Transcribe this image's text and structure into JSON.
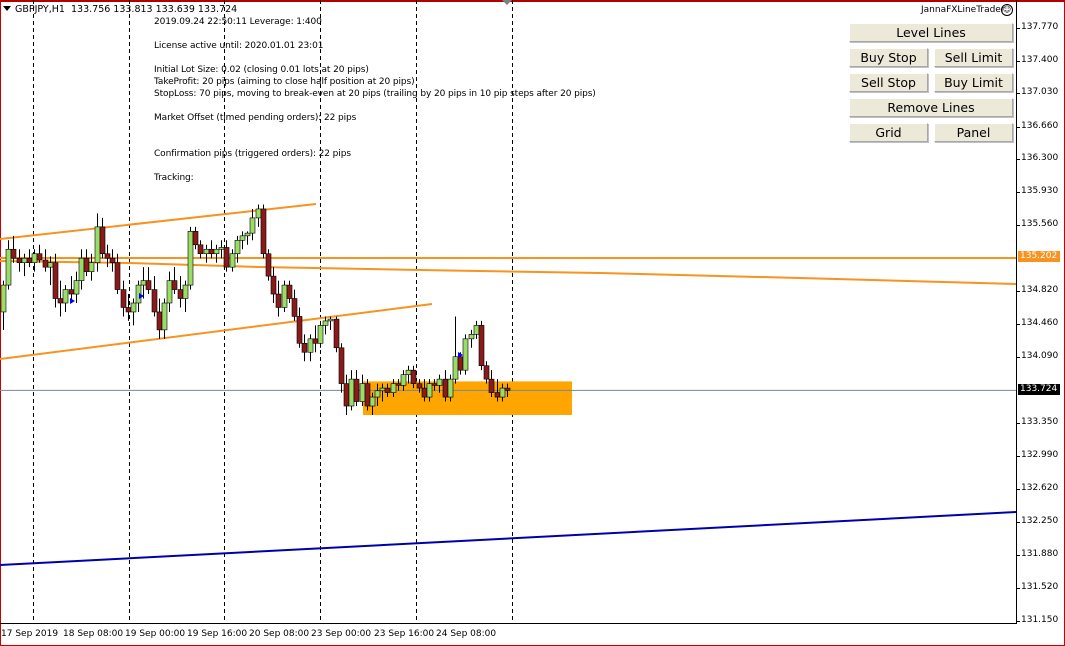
{
  "chart_header": {
    "symbol_timeframe": "GBPJPY,H1",
    "ohlc": "133.756 133.813 133.639 133.724"
  },
  "ea_info": {
    "name": "JannaFXLineTrader",
    "smiley": "☺",
    "lines": [
      "2019.09.24 22:50:11    Leverage: 1:400",
      "License active until: 2020.01.01 23:01",
      "Initial Lot Size: 0.02  (closing 0.01 lots at 20 pips)",
      "TakeProfit: 20 pips  (aiming to close half position at 20 pips)",
      "StopLoss: 70 pips, moving to break-even at 20 pips  (trailing by 20 pips in 10 pip steps after 20 pips)",
      "Market Offset (timed pending orders): 22 pips",
      "Confirmation pips (triggered orders): 22 pips",
      "Tracking:"
    ]
  },
  "panel": {
    "level_lines": "Level Lines",
    "buy_stop": "Buy Stop",
    "sell_limit": "Sell Limit",
    "sell_stop": "Sell Stop",
    "buy_limit": "Buy Limit",
    "remove_lines": "Remove Lines",
    "grid": "Grid",
    "panel": "Panel"
  },
  "colors": {
    "bull": "#99dd66",
    "bear": "#8b1a1a",
    "trendline": "#f7931e",
    "support_line": "#0000aa",
    "zone": "#ffa500",
    "bid_line": "#778899",
    "bid_tag_bg": "#000000",
    "level_tag_bg": "#f7931e"
  },
  "chart_data": {
    "type": "candlestick",
    "symbol": "GBPJPY",
    "timeframe": "H1",
    "y_ticks": [
      "137.770",
      "137.400",
      "137.030",
      "136.660",
      "136.300",
      "135.930",
      "135.560",
      "135.202",
      "134.820",
      "134.460",
      "134.090",
      "133.724",
      "133.350",
      "132.990",
      "132.620",
      "132.250",
      "131.880",
      "131.520",
      "131.150"
    ],
    "y_tick_values": [
      137.77,
      137.4,
      137.03,
      136.66,
      136.3,
      135.93,
      135.56,
      134.82,
      134.46,
      134.09,
      133.35,
      132.99,
      132.62,
      132.25,
      131.88,
      131.52,
      131.15
    ],
    "ylim": [
      131.15,
      137.95
    ],
    "x_ticks": [
      "17 Sep 2019",
      "18 Sep 08:00",
      "19 Sep 00:00",
      "19 Sep 16:00",
      "20 Sep 08:00",
      "23 Sep 00:00",
      "23 Sep 16:00",
      "24 Sep 08:00"
    ],
    "current_bid": 133.724,
    "level_line_price": 135.202,
    "candles": [
      [
        134.6,
        134.95,
        134.4,
        134.9
      ],
      [
        134.9,
        135.4,
        134.85,
        135.3
      ],
      [
        135.3,
        135.45,
        135.15,
        135.2
      ],
      [
        135.2,
        135.3,
        135.05,
        135.15
      ],
      [
        135.15,
        135.25,
        135.0,
        135.2
      ],
      [
        135.2,
        135.3,
        135.1,
        135.15
      ],
      [
        135.15,
        135.3,
        135.05,
        135.25
      ],
      [
        135.25,
        135.35,
        135.15,
        135.18
      ],
      [
        135.18,
        135.3,
        135.05,
        135.1
      ],
      [
        135.1,
        135.22,
        134.9,
        135.15
      ],
      [
        135.15,
        135.25,
        134.65,
        134.75
      ],
      [
        134.75,
        134.95,
        134.55,
        134.7
      ],
      [
        134.7,
        134.9,
        134.6,
        134.85
      ],
      [
        134.85,
        135.0,
        134.7,
        134.8
      ],
      [
        134.8,
        135.05,
        134.7,
        134.95
      ],
      [
        134.95,
        135.3,
        134.85,
        135.2
      ],
      [
        135.2,
        135.3,
        135.0,
        135.05
      ],
      [
        135.05,
        135.25,
        134.95,
        135.15
      ],
      [
        135.15,
        135.7,
        135.05,
        135.55
      ],
      [
        135.55,
        135.65,
        135.2,
        135.25
      ],
      [
        135.25,
        135.35,
        135.1,
        135.2
      ],
      [
        135.2,
        135.3,
        135.05,
        135.15
      ],
      [
        135.15,
        135.25,
        134.8,
        134.85
      ],
      [
        134.85,
        134.95,
        134.55,
        134.65
      ],
      [
        134.65,
        134.8,
        134.5,
        134.6
      ],
      [
        134.6,
        134.75,
        134.45,
        134.7
      ],
      [
        134.7,
        134.95,
        134.6,
        134.9
      ],
      [
        134.9,
        135.1,
        134.75,
        134.95
      ],
      [
        134.95,
        135.1,
        134.8,
        134.85
      ],
      [
        134.85,
        135.0,
        134.55,
        134.6
      ],
      [
        134.6,
        134.75,
        134.3,
        134.4
      ],
      [
        134.4,
        134.75,
        134.3,
        134.7
      ],
      [
        134.7,
        135.05,
        134.6,
        134.95
      ],
      [
        134.95,
        135.1,
        134.8,
        134.85
      ],
      [
        134.85,
        135.0,
        134.65,
        134.75
      ],
      [
        134.75,
        134.95,
        134.6,
        134.9
      ],
      [
        134.9,
        135.55,
        134.85,
        135.5
      ],
      [
        135.5,
        135.55,
        135.3,
        135.35
      ],
      [
        135.35,
        135.4,
        135.2,
        135.25
      ],
      [
        135.25,
        135.35,
        135.15,
        135.3
      ],
      [
        135.3,
        135.4,
        135.2,
        135.25
      ],
      [
        135.25,
        135.35,
        135.15,
        135.3
      ],
      [
        135.3,
        135.4,
        135.2,
        135.32
      ],
      [
        135.32,
        135.4,
        135.05,
        135.1
      ],
      [
        135.1,
        135.3,
        135.05,
        135.25
      ],
      [
        135.25,
        135.45,
        135.15,
        135.4
      ],
      [
        135.4,
        135.5,
        135.3,
        135.45
      ],
      [
        135.45,
        135.5,
        135.35,
        135.48
      ],
      [
        135.48,
        135.75,
        135.4,
        135.65
      ],
      [
        135.65,
        135.8,
        135.55,
        135.75
      ],
      [
        135.75,
        135.8,
        135.2,
        135.25
      ],
      [
        135.25,
        135.3,
        134.95,
        135.0
      ],
      [
        135.0,
        135.1,
        134.7,
        134.8
      ],
      [
        134.8,
        134.95,
        134.55,
        134.65
      ],
      [
        134.65,
        134.95,
        134.6,
        134.9
      ],
      [
        134.9,
        134.95,
        134.7,
        134.75
      ],
      [
        134.75,
        134.85,
        134.5,
        134.55
      ],
      [
        134.55,
        134.65,
        134.2,
        134.25
      ],
      [
        134.25,
        134.35,
        134.05,
        134.15
      ],
      [
        134.15,
        134.35,
        134.05,
        134.3
      ],
      [
        134.3,
        134.45,
        134.15,
        134.25
      ],
      [
        134.25,
        134.5,
        134.2,
        134.45
      ],
      [
        134.45,
        134.55,
        134.35,
        134.5
      ],
      [
        134.5,
        134.55,
        134.4,
        134.52
      ],
      [
        134.52,
        134.55,
        134.15,
        134.2
      ],
      [
        134.2,
        134.25,
        133.7,
        133.8
      ],
      [
        133.8,
        133.9,
        133.45,
        133.55
      ],
      [
        133.55,
        133.95,
        133.5,
        133.85
      ],
      [
        133.85,
        133.95,
        133.55,
        133.6
      ],
      [
        133.6,
        133.9,
        133.55,
        133.8
      ],
      [
        133.8,
        133.85,
        133.5,
        133.55
      ],
      [
        133.55,
        133.7,
        133.45,
        133.65
      ],
      [
        133.65,
        133.8,
        133.55,
        133.72
      ],
      [
        133.72,
        133.8,
        133.6,
        133.75
      ],
      [
        133.75,
        133.8,
        133.65,
        133.7
      ],
      [
        133.7,
        133.85,
        133.65,
        133.8
      ],
      [
        133.8,
        133.85,
        133.72,
        133.78
      ],
      [
        133.78,
        133.95,
        133.72,
        133.9
      ],
      [
        133.9,
        134.0,
        133.8,
        133.95
      ],
      [
        133.95,
        134.0,
        133.75,
        133.8
      ],
      [
        133.8,
        133.85,
        133.7,
        133.75
      ],
      [
        133.75,
        133.85,
        133.6,
        133.65
      ],
      [
        133.65,
        133.85,
        133.6,
        133.8
      ],
      [
        133.8,
        133.85,
        133.72,
        133.78
      ],
      [
        133.78,
        133.9,
        133.7,
        133.85
      ],
      [
        133.85,
        133.95,
        133.6,
        133.65
      ],
      [
        133.65,
        133.9,
        133.6,
        133.85
      ],
      [
        133.85,
        134.55,
        133.8,
        134.1
      ],
      [
        134.1,
        134.15,
        133.9,
        133.95
      ],
      [
        133.95,
        134.35,
        133.9,
        134.3
      ],
      [
        134.3,
        134.4,
        134.2,
        134.35
      ],
      [
        134.35,
        134.5,
        134.3,
        134.45
      ],
      [
        134.45,
        134.5,
        133.95,
        134.0
      ],
      [
        134.0,
        134.05,
        133.8,
        133.85
      ],
      [
        133.85,
        133.95,
        133.65,
        133.7
      ],
      [
        133.7,
        133.85,
        133.6,
        133.65
      ],
      [
        133.65,
        133.8,
        133.6,
        133.75
      ],
      [
        133.75,
        133.8,
        133.65,
        133.724
      ]
    ],
    "trendlines": [
      {
        "name": "upper-channel",
        "color": "#f7931e"
      },
      {
        "name": "mid-channel-sloped",
        "color": "#f7931e"
      },
      {
        "name": "lower-channel",
        "color": "#f7931e"
      },
      {
        "name": "horizontal-level",
        "price": 135.202,
        "color": "#f7931e"
      },
      {
        "name": "long-support",
        "color": "#0000aa"
      }
    ],
    "zone": {
      "name": "supply-demand-zone",
      "price_top": 133.78,
      "price_bottom": 133.45,
      "color": "#ffa500"
    },
    "arrows": [
      {
        "name": "buy-arrow",
        "color": "#0000ff"
      },
      {
        "name": "buy-arrow",
        "color": "#0000ff"
      },
      {
        "name": "buy-arrow",
        "color": "#0000ff"
      }
    ]
  }
}
